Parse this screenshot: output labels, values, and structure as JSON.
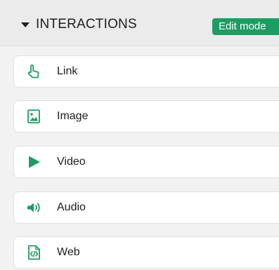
{
  "header": {
    "title": "INTERACTIONS",
    "edit_mode_label": "Edit mode"
  },
  "colors": {
    "accent": "#1d9d63",
    "header_bg": "#ebebeb",
    "panel_bg": "#f2f2f2",
    "item_bg": "#ffffff"
  },
  "items": [
    {
      "label": "Link",
      "icon": "pointer-hand-icon"
    },
    {
      "label": "Image",
      "icon": "image-icon"
    },
    {
      "label": "Video",
      "icon": "play-icon"
    },
    {
      "label": "Audio",
      "icon": "speaker-icon"
    },
    {
      "label": "Web",
      "icon": "web-code-icon"
    }
  ]
}
